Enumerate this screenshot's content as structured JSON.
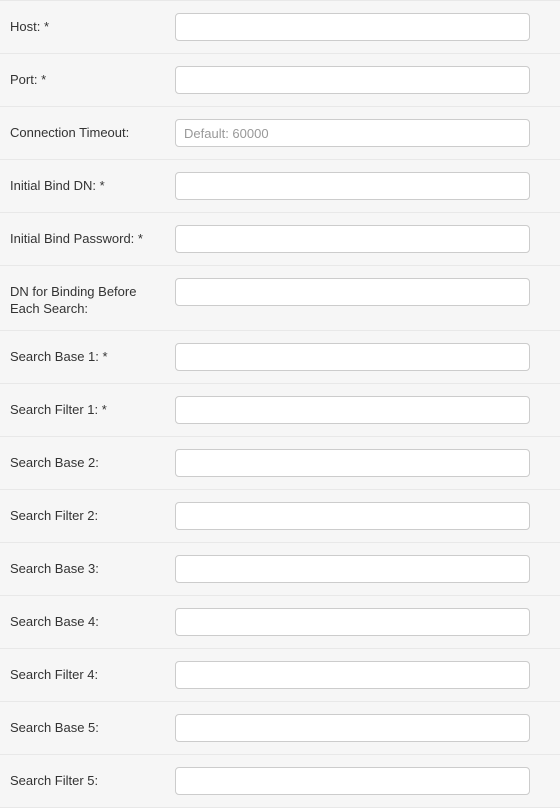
{
  "fields": [
    {
      "id": "host",
      "label": "Host: *",
      "value": "",
      "placeholder": ""
    },
    {
      "id": "port",
      "label": "Port: *",
      "value": "",
      "placeholder": ""
    },
    {
      "id": "connection-timeout",
      "label": "Connection Timeout:",
      "value": "",
      "placeholder": "Default: 60000"
    },
    {
      "id": "initial-bind-dn",
      "label": "Initial Bind DN: *",
      "value": "",
      "placeholder": ""
    },
    {
      "id": "initial-bind-password",
      "label": "Initial Bind Password: *",
      "value": "",
      "placeholder": ""
    },
    {
      "id": "dn-binding-before-search",
      "label": "DN for Binding Before Each Search:",
      "value": "",
      "placeholder": ""
    },
    {
      "id": "search-base-1",
      "label": "Search Base 1: *",
      "value": "",
      "placeholder": ""
    },
    {
      "id": "search-filter-1",
      "label": "Search Filter 1: *",
      "value": "",
      "placeholder": ""
    },
    {
      "id": "search-base-2",
      "label": "Search Base 2:",
      "value": "",
      "placeholder": ""
    },
    {
      "id": "search-filter-2",
      "label": "Search Filter 2:",
      "value": "",
      "placeholder": ""
    },
    {
      "id": "search-base-3",
      "label": "Search Base 3:",
      "value": "",
      "placeholder": ""
    },
    {
      "id": "search-base-4",
      "label": "Search Base 4:",
      "value": "",
      "placeholder": ""
    },
    {
      "id": "search-filter-4",
      "label": "Search Filter 4:",
      "value": "",
      "placeholder": ""
    },
    {
      "id": "search-base-5",
      "label": "Search Base 5:",
      "value": "",
      "placeholder": ""
    },
    {
      "id": "search-filter-5",
      "label": "Search Filter 5:",
      "value": "",
      "placeholder": ""
    }
  ]
}
